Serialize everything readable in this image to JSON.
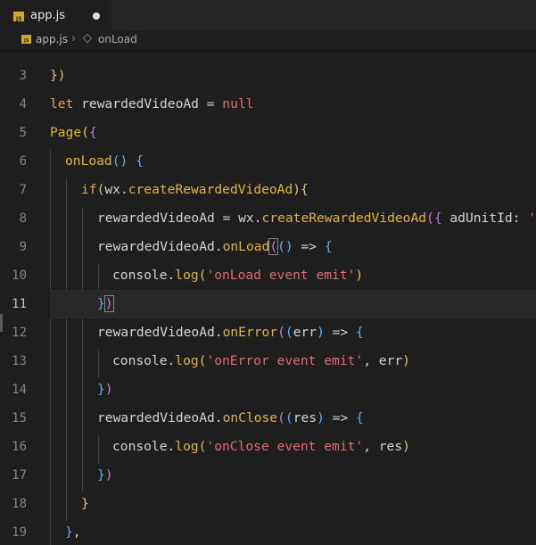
{
  "tab": {
    "title": "app.js",
    "icon": "js-file-icon",
    "icon_text": "JS",
    "dirty": true
  },
  "breadcrumb": {
    "file": "app.js",
    "separator": "›",
    "symbol": "onLoad",
    "symbol_icon": "method-cube-icon"
  },
  "colors": {
    "keyword": "#e0a35a",
    "function": "#e2b53c",
    "string": "#e06c75",
    "bracket_gold": "#e5c07b",
    "bracket_purple": "#c678dd",
    "bracket_blue": "#61afef",
    "background": "#1e1e1e",
    "line_numbers": "#858585"
  },
  "active_line": 11,
  "lines": [
    {
      "n": "3",
      "text": "})"
    },
    {
      "n": "4",
      "text": "let rewardedVideoAd = null"
    },
    {
      "n": "5",
      "text": "Page({"
    },
    {
      "n": "6",
      "text": "onLoad() {"
    },
    {
      "n": "7",
      "text": "if(wx.createRewardedVideoAd){"
    },
    {
      "n": "8",
      "text": "rewardedVideoAd = wx.createRewardedVideoAd({ adUnitId: '"
    },
    {
      "n": "9",
      "text": "rewardedVideoAd.onLoad(() => {"
    },
    {
      "n": "10",
      "text": "console.log('onLoad event emit')"
    },
    {
      "n": "11",
      "text": "})"
    },
    {
      "n": "12",
      "text": "rewardedVideoAd.onError((err) => {"
    },
    {
      "n": "13",
      "text": "console.log('onError event emit', err)"
    },
    {
      "n": "14",
      "text": "})"
    },
    {
      "n": "15",
      "text": "rewardedVideoAd.onClose((res) => {"
    },
    {
      "n": "16",
      "text": "console.log('onClose event emit', res)"
    },
    {
      "n": "17",
      "text": "})"
    },
    {
      "n": "18",
      "text": "}"
    },
    {
      "n": "19",
      "text": "},"
    }
  ]
}
